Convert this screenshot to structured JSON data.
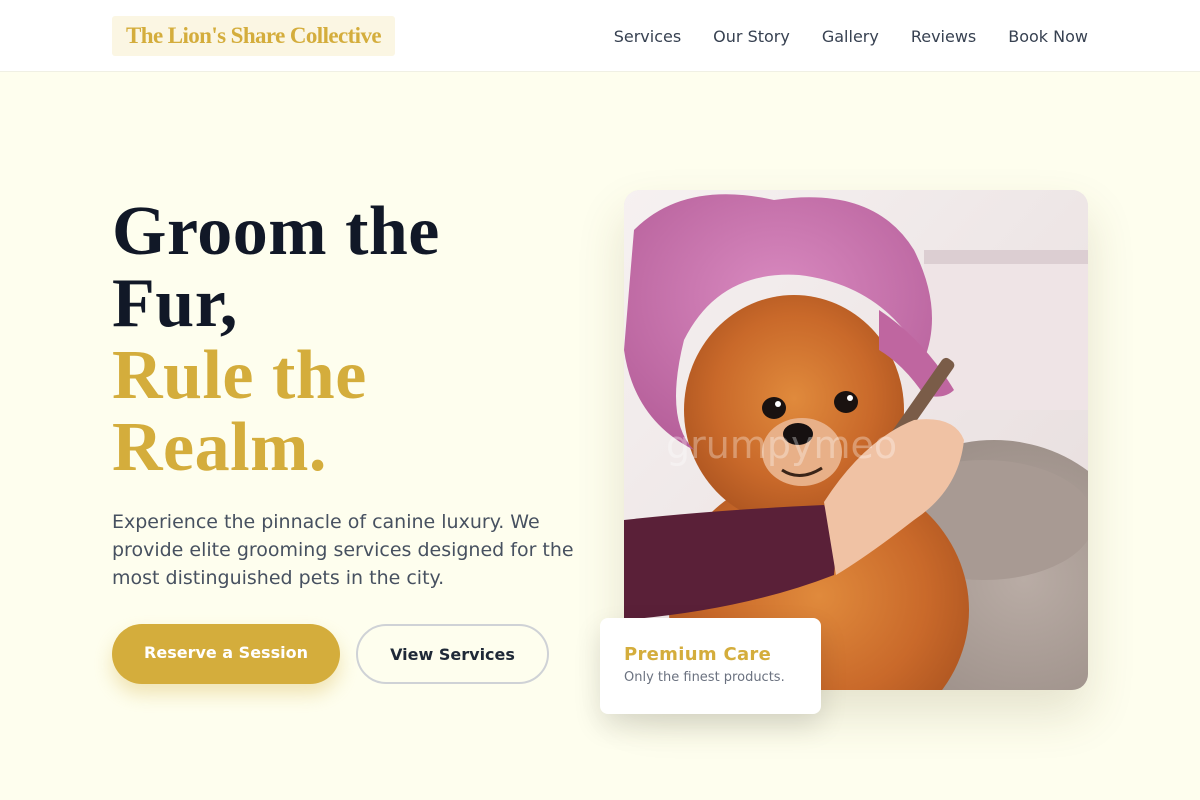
{
  "header": {
    "logo": "The Lion's Share Collective",
    "nav": [
      "Services",
      "Our Story",
      "Gallery",
      "Reviews",
      "Book Now"
    ]
  },
  "hero": {
    "headline_line1": "Groom the",
    "headline_line2": "Fur,",
    "headline_line3": "Rule the",
    "headline_line4": "Realm.",
    "subtext": "Experience the pinnacle of canine luxury. We provide elite grooming services designed for the most distinguished pets in the city.",
    "primary_button": "Reserve a Session",
    "secondary_button": "View Services",
    "image_watermark": "grumpymeo"
  },
  "badge": {
    "title": "Premium Care",
    "subtitle": "Only the finest products."
  },
  "colors": {
    "page_background": "#fefeee",
    "accent_gold": "#d4ad3c",
    "headline_dark": "#111827",
    "body_text": "#475160"
  }
}
